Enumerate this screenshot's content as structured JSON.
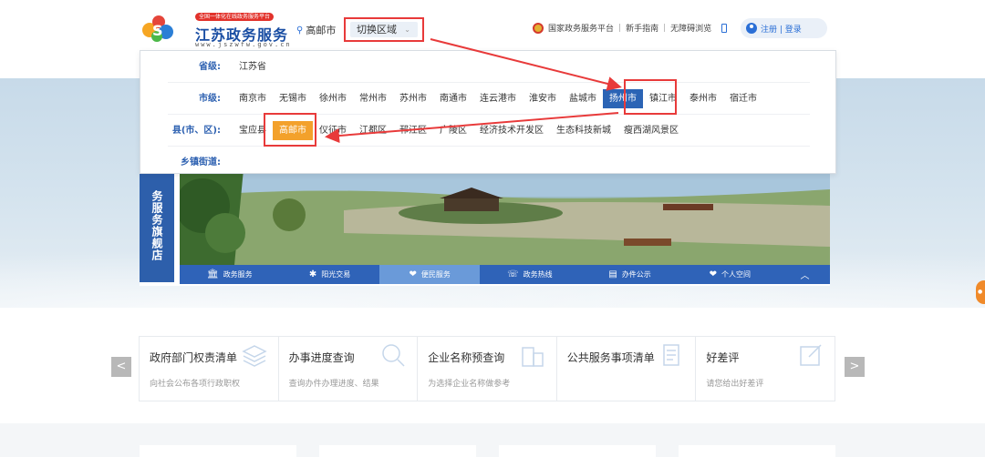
{
  "header": {
    "logo_badge": "全国一体化在线政务服务平台",
    "logo_title": "江苏政务服务",
    "logo_url": "www.jszwfw.gov.cn",
    "current_location": "高邮市",
    "switch_region_label": "切换区域",
    "links": [
      "国家政务服务平台",
      "新手指南",
      "无障碍浏览"
    ],
    "login_label": "注册 | 登录"
  },
  "dropdown": {
    "province_label": "省级:",
    "province": [
      "江苏省"
    ],
    "city_label": "市级:",
    "cities": [
      "南京市",
      "无锡市",
      "徐州市",
      "常州市",
      "苏州市",
      "南通市",
      "连云港市",
      "淮安市",
      "盐城市",
      "扬州市",
      "镇江市",
      "泰州市",
      "宿迁市"
    ],
    "selected_city": "扬州市",
    "county_label": "县(市、区):",
    "counties": [
      "宝应县",
      "高邮市",
      "仪征市",
      "江都区",
      "邗江区",
      "广陵区",
      "经济技术开发区",
      "生态科技新城",
      "瘦西湖风景区"
    ],
    "selected_county": "高邮市",
    "town_label": "乡镇街道:"
  },
  "flagship": {
    "label": "务服务旗舰店",
    "nav": [
      {
        "icon": "government-icon",
        "glyph": "🏛",
        "label": "政务服务"
      },
      {
        "icon": "network-icon",
        "glyph": "✱",
        "label": "阳光交易"
      },
      {
        "icon": "heart-icon",
        "glyph": "❤",
        "label": "便民服务"
      },
      {
        "icon": "hotline-icon",
        "glyph": "☏",
        "label": "政务热线"
      },
      {
        "icon": "notice-icon",
        "glyph": "▤",
        "label": "办件公示"
      },
      {
        "icon": "personal-icon",
        "glyph": "❤",
        "label": "个人空间"
      }
    ],
    "active_nav": "便民服务"
  },
  "cards": [
    {
      "title": "政府部门权责清单",
      "sub": "向社会公布各项行政职权"
    },
    {
      "title": "办事进度查询",
      "sub": "查询办件办理进度、结果"
    },
    {
      "title": "企业名称预查询",
      "sub": "为选择企业名称做参考"
    },
    {
      "title": "公共服务事项清单",
      "sub": ""
    },
    {
      "title": "好差评",
      "sub": "请您给出好差评"
    }
  ],
  "carousel": {
    "prev": "<",
    "next": ">"
  },
  "colors": {
    "primary": "#2b64b5",
    "highlight_orange": "#f3a12b",
    "annotation_red": "#e83a3a"
  }
}
